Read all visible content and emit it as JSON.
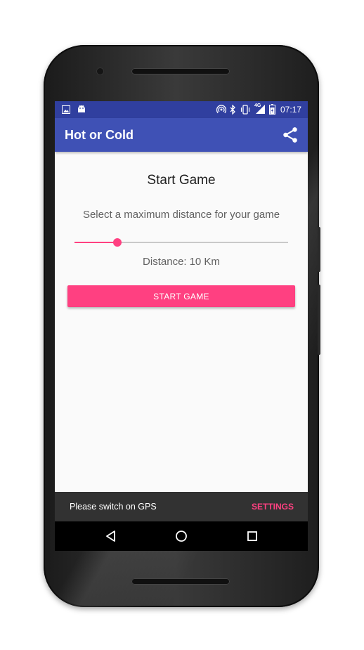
{
  "status_bar": {
    "time": "07:17",
    "network": "4G",
    "left_icons": [
      "image-icon",
      "android-icon"
    ],
    "right_icons": [
      "hotspot-icon",
      "bluetooth-icon",
      "vibrate-icon",
      "signal-icon",
      "battery-icon"
    ]
  },
  "app_bar": {
    "title": "Hot or Cold",
    "action_icon": "share-icon"
  },
  "main": {
    "heading": "Start Game",
    "subtitle": "Select a maximum distance for your game",
    "slider": {
      "value_fraction": 0.2
    },
    "distance_label": "Distance:",
    "distance_value": "10 Km",
    "start_button": "START GAME"
  },
  "snackbar": {
    "message": "Please switch on GPS",
    "action": "SETTINGS"
  },
  "nav_bar": {
    "buttons": [
      "back-icon",
      "home-icon",
      "recents-icon"
    ]
  },
  "colors": {
    "primary": "#3f51b5",
    "primary_dark": "#303f9f",
    "accent": "#ff4081",
    "snackbar": "#323232",
    "background": "#fafafa"
  }
}
